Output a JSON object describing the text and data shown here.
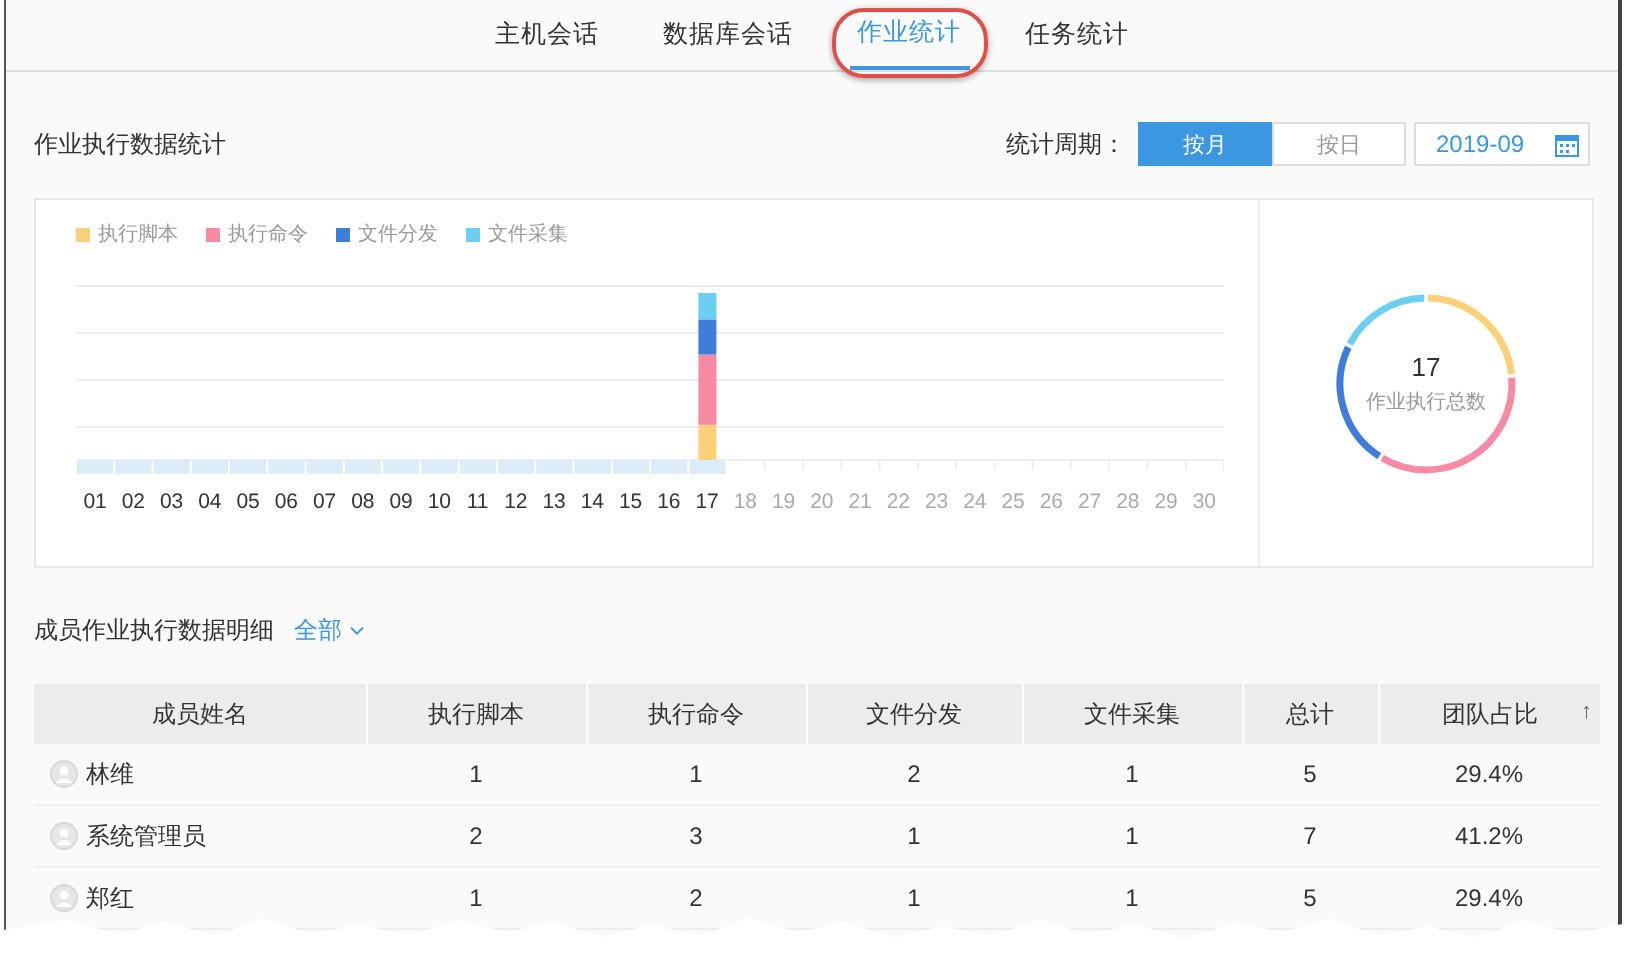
{
  "tabs": [
    {
      "label": "主机会话",
      "selected": false,
      "annotated": false
    },
    {
      "label": "数据库会话",
      "selected": false,
      "annotated": false
    },
    {
      "label": "作业统计",
      "selected": true,
      "annotated": true
    },
    {
      "label": "任务统计",
      "selected": false,
      "annotated": false
    }
  ],
  "stats_header": {
    "title": "作业执行数据统计",
    "period_label": "统计周期：",
    "period_options": [
      {
        "label": "按月",
        "selected": true
      },
      {
        "label": "按日",
        "selected": false
      }
    ],
    "month_value": "2019-09"
  },
  "legend": [
    {
      "label": "执行脚本",
      "color": "#fbd07a"
    },
    {
      "label": "执行命令",
      "color": "#f88aa4"
    },
    {
      "label": "文件分发",
      "color": "#3f7ddb"
    },
    {
      "label": "文件采集",
      "color": "#6dcff0"
    }
  ],
  "days": [
    {
      "label": "01",
      "disabled": false
    },
    {
      "label": "02",
      "disabled": false
    },
    {
      "label": "03",
      "disabled": false
    },
    {
      "label": "04",
      "disabled": false
    },
    {
      "label": "05",
      "disabled": false
    },
    {
      "label": "06",
      "disabled": false
    },
    {
      "label": "07",
      "disabled": false
    },
    {
      "label": "08",
      "disabled": false
    },
    {
      "label": "09",
      "disabled": false
    },
    {
      "label": "10",
      "disabled": false
    },
    {
      "label": "11",
      "disabled": false
    },
    {
      "label": "12",
      "disabled": false
    },
    {
      "label": "13",
      "disabled": false
    },
    {
      "label": "14",
      "disabled": false
    },
    {
      "label": "15",
      "disabled": false
    },
    {
      "label": "16",
      "disabled": false
    },
    {
      "label": "17",
      "disabled": false
    },
    {
      "label": "18",
      "disabled": true
    },
    {
      "label": "19",
      "disabled": true
    },
    {
      "label": "20",
      "disabled": true
    },
    {
      "label": "21",
      "disabled": true
    },
    {
      "label": "22",
      "disabled": true
    },
    {
      "label": "23",
      "disabled": true
    },
    {
      "label": "24",
      "disabled": true
    },
    {
      "label": "25",
      "disabled": true
    },
    {
      "label": "26",
      "disabled": true
    },
    {
      "label": "27",
      "disabled": true
    },
    {
      "label": "28",
      "disabled": true
    },
    {
      "label": "29",
      "disabled": true
    },
    {
      "label": "30",
      "disabled": true
    }
  ],
  "total": {
    "value": "17",
    "label": "作业执行总数"
  },
  "detail": {
    "title": "成员作业执行数据明细",
    "filter": "全部"
  },
  "table": {
    "columns": [
      "成员姓名",
      "执行脚本",
      "执行命令",
      "文件分发",
      "文件采集",
      "总计",
      "团队占比"
    ],
    "sort_indicator": "↑",
    "rows": [
      [
        "林维",
        "1",
        "1",
        "2",
        "1",
        "5",
        "29.4%"
      ],
      [
        "系统管理员",
        "2",
        "3",
        "1",
        "1",
        "7",
        "41.2%"
      ],
      [
        "郑红",
        "1",
        "2",
        "1",
        "1",
        "5",
        "29.4%"
      ]
    ]
  }
}
